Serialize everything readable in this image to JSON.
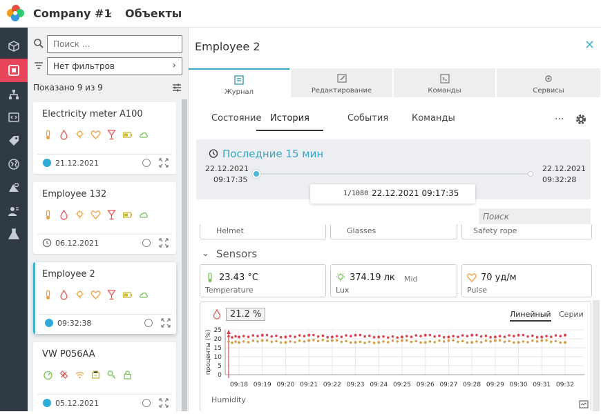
{
  "header": {
    "company": "Company #1",
    "section": "Объекты"
  },
  "rail": {
    "items": [
      "cube-icon",
      "objects-icon",
      "hierarchy-icon",
      "code-icon",
      "tag-icon",
      "globe-icon",
      "geozone-icon",
      "users-icon",
      "flask-icon"
    ],
    "active": "objects-icon",
    "active_color": "#e8445a"
  },
  "list": {
    "search_placeholder": "Поиск ...",
    "filter_value": "Нет фильтров",
    "shown_text": "Показано 9 из 9",
    "cards": [
      {
        "name": "Electricity meter A100",
        "date": "21.12.2021",
        "status": "online",
        "icons": [
          "thermometer-icon",
          "drop-icon",
          "bulb-icon",
          "heart-icon",
          "glass-icon",
          "battery-icon",
          "cloud-icon"
        ]
      },
      {
        "name": "Employee 132",
        "date": "06.12.2021",
        "status": "clock",
        "icons": [
          "thermometer-icon",
          "drop-icon",
          "bulb-icon",
          "heart-icon",
          "glass-icon",
          "battery-icon",
          "cloud-icon"
        ]
      },
      {
        "name": "Employee 2",
        "date": "09:32:38",
        "status": "online",
        "selected": true,
        "icons": [
          "thermometer-icon",
          "drop-icon",
          "bulb-icon",
          "heart-icon",
          "glass-icon",
          "battery-icon",
          "cloud-icon"
        ]
      },
      {
        "name": "VW P056AA",
        "date": "05.12.2021",
        "status": "online",
        "icons": [
          "speed-icon",
          "satellite-icon",
          "wifi-icon",
          "engine-icon",
          "key-icon",
          "lock-icon"
        ]
      }
    ]
  },
  "detail": {
    "title": "Employee 2",
    "tabs": [
      "Журнал",
      "Редактирование",
      "Команды",
      "Сервисы"
    ],
    "subtabs": [
      "Состояние",
      "История",
      "События",
      "Команды"
    ],
    "active_subtab": "История",
    "range": {
      "label": "Последние 15 мин",
      "start_date": "22.12.2021",
      "start_time": "09:17:35",
      "end_date": "22.12.2021",
      "end_time": "09:32:28",
      "cursor_count": "1/1080",
      "cursor_time": "22.12.2021 09:17:35"
    },
    "search_placeholder": "Поиск",
    "top_tiles": [
      "Helmet",
      "Glasses",
      "Safety rope"
    ],
    "sensors_title": "Sensors",
    "tiles": [
      {
        "value": "23.43 °C",
        "sub": "",
        "name": "Temperature",
        "icon": "thermometer-icon"
      },
      {
        "value": "374.19 лк",
        "sub": "Mid",
        "name": "Lux",
        "icon": "bulb-icon"
      },
      {
        "value": "70 уд/м",
        "sub": "",
        "name": "Pulse",
        "icon": "heart-icon"
      }
    ],
    "chart_widget": {
      "current": "21.2 %",
      "linear_label": "Линейный",
      "series_label": "Серии",
      "name": "Humidity"
    }
  },
  "chart_data": {
    "type": "scatter",
    "title": "",
    "ylabel": "проценты (%)",
    "ylim": [
      0,
      25
    ],
    "yticks": [
      0,
      5,
      10,
      15,
      20,
      25
    ],
    "x": [
      "09:18",
      "09:19",
      "09:20",
      "09:21",
      "09:22",
      "09:23",
      "09:24",
      "09:25",
      "09:26",
      "09:27",
      "09:28",
      "09:29",
      "09:30",
      "09:31",
      "09:32"
    ],
    "series": [
      {
        "values": [
          21,
          22,
          21,
          22,
          21,
          22,
          21,
          21,
          22,
          21,
          22,
          21,
          22,
          21,
          22
        ],
        "color": "#d9434f"
      },
      {
        "values": [
          18,
          19,
          18,
          19,
          19,
          18,
          18,
          19,
          18,
          19,
          18,
          19,
          18,
          19,
          18
        ],
        "color": "#d1a34c"
      }
    ],
    "grid": true
  }
}
